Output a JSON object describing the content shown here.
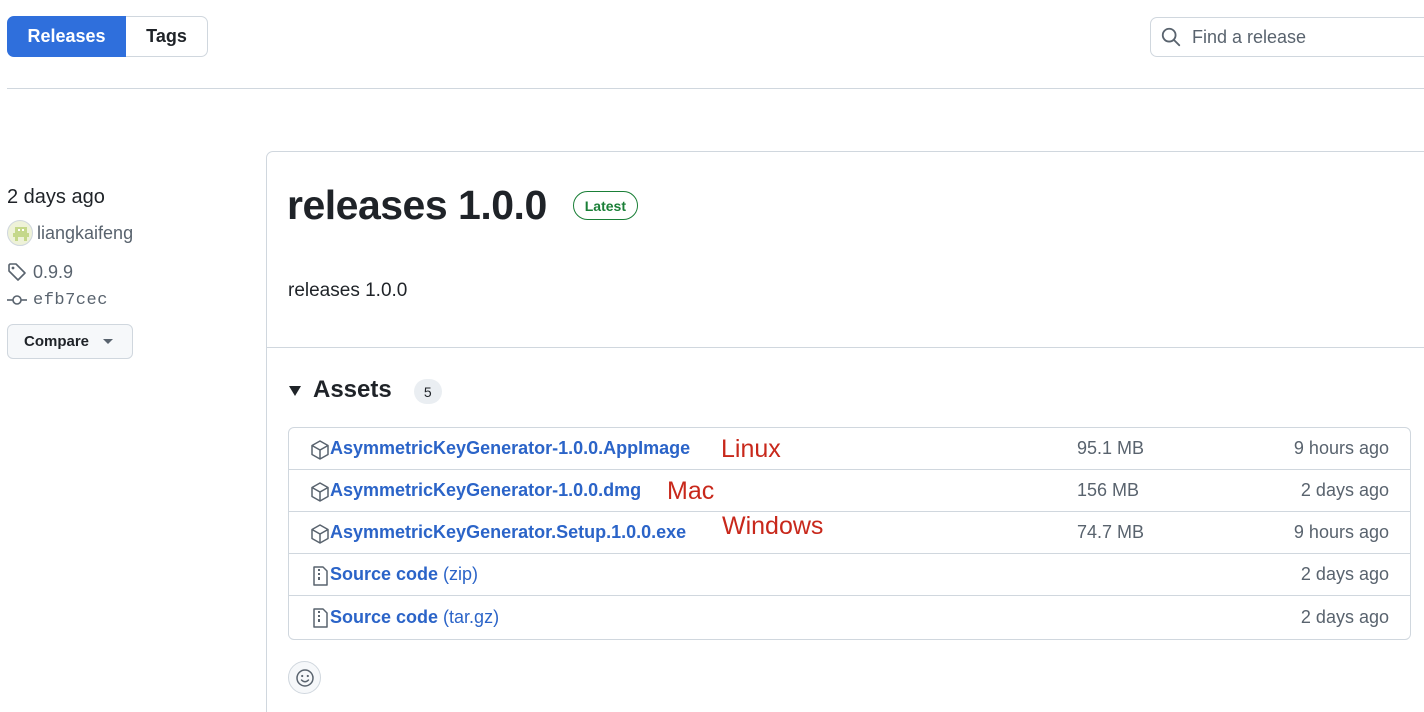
{
  "tabs": [
    {
      "label": "Releases",
      "active": true
    },
    {
      "label": "Tags",
      "active": false
    }
  ],
  "search": {
    "placeholder": "Find a release",
    "value": "",
    "icon": "search-icon"
  },
  "sidebar": {
    "date": "2 days ago",
    "author": "liangkaifeng",
    "tag": "0.9.9",
    "commit": "efb7cec",
    "compare_label": "Compare"
  },
  "release": {
    "title": "releases 1.0.0",
    "badge": "Latest",
    "body": "releases 1.0.0"
  },
  "assets": {
    "title": "Assets",
    "count": "5",
    "rows": [
      {
        "name": "AsymmetricKeyGenerator-1.0.0.AppImage",
        "suffix": "",
        "annotation": "Linux",
        "size": "95.1 MB",
        "when": "9 hours ago",
        "icon": "package-icon"
      },
      {
        "name": "AsymmetricKeyGenerator-1.0.0.dmg",
        "suffix": "",
        "annotation": "Mac",
        "size": "156 MB",
        "when": "2 days ago",
        "icon": "package-icon"
      },
      {
        "name": "AsymmetricKeyGenerator.Setup.1.0.0.exe",
        "suffix": "",
        "annotation": "Windows",
        "size": "74.7 MB",
        "when": "9 hours ago",
        "icon": "package-icon"
      },
      {
        "name": "Source code",
        "suffix": " (zip)",
        "annotation": "",
        "size": "",
        "when": "2 days ago",
        "icon": "file-zip-icon"
      },
      {
        "name": "Source code",
        "suffix": " (tar.gz)",
        "annotation": "",
        "size": "",
        "when": "2 days ago",
        "icon": "file-zip-icon"
      }
    ]
  },
  "colors": {
    "accent": "#2f6fdc",
    "link": "#2b64c8",
    "latest": "#1a7f37",
    "annotation": "#c8281b"
  }
}
